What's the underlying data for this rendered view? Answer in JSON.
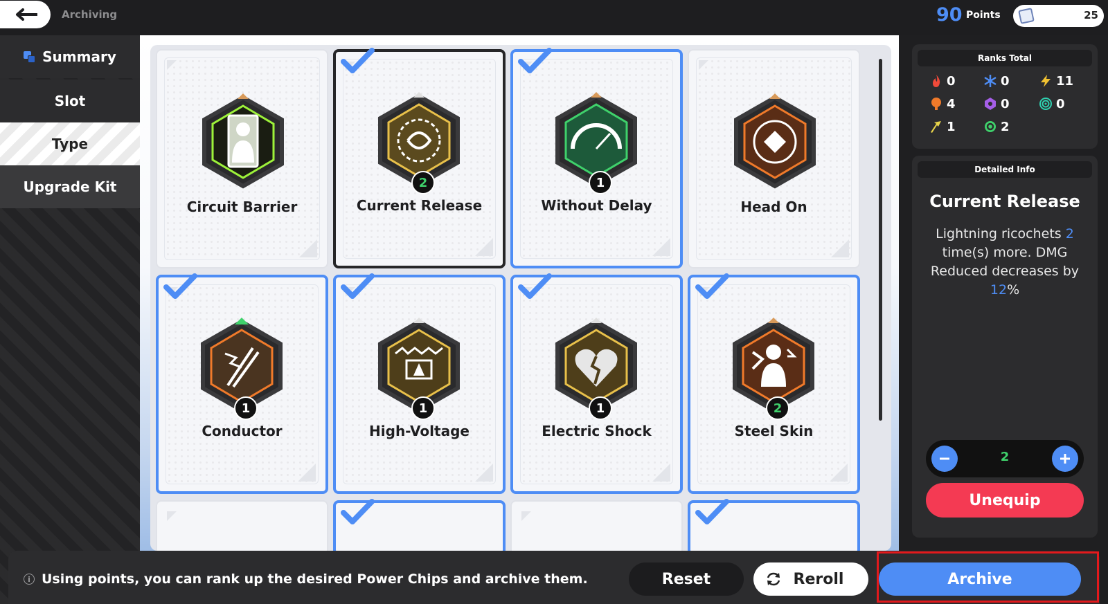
{
  "header": {
    "breadcrumb": "Archiving",
    "points_value": "90",
    "points_label": "Points",
    "upgrade_kit_count": "25"
  },
  "sidebar": {
    "items": [
      {
        "label": "Summary"
      },
      {
        "label": "Slot"
      },
      {
        "label": "Type"
      },
      {
        "label": "Upgrade Kit"
      }
    ]
  },
  "chips": [
    {
      "name": "Circuit Barrier",
      "rank": "",
      "selected": false,
      "theme": "green-neon"
    },
    {
      "name": "Current Release",
      "rank": "2",
      "selected": true,
      "theme": "gold"
    },
    {
      "name": "Without Delay",
      "rank": "1",
      "selected": true,
      "theme": "green"
    },
    {
      "name": "Head On",
      "rank": "",
      "selected": false,
      "theme": "orange"
    },
    {
      "name": "Conductor",
      "rank": "1",
      "selected": true,
      "theme": "orange"
    },
    {
      "name": "High-Voltage",
      "rank": "1",
      "selected": true,
      "theme": "gold"
    },
    {
      "name": "Electric Shock",
      "rank": "1",
      "selected": true,
      "theme": "gold"
    },
    {
      "name": "Steel Skin",
      "rank": "2",
      "selected": true,
      "theme": "orange"
    }
  ],
  "ranks_total": {
    "title": "Ranks Total",
    "items": [
      {
        "icon": "fire-icon",
        "value": "0",
        "color": "#f04a3a"
      },
      {
        "icon": "frost-icon",
        "value": "0",
        "color": "#4e8df5"
      },
      {
        "icon": "lightning-icon",
        "value": "11",
        "color": "#f1c232"
      },
      {
        "icon": "blast-icon",
        "value": "4",
        "color": "#f07a2a"
      },
      {
        "icon": "poison-icon",
        "value": "0",
        "color": "#a55ee8"
      },
      {
        "icon": "vortex-icon",
        "value": "0",
        "color": "#2fd0b0"
      },
      {
        "icon": "physical-icon",
        "value": "1",
        "color": "#e8d44a"
      },
      {
        "icon": "cycle-icon",
        "value": "2",
        "color": "#3fd16b"
      }
    ]
  },
  "detail": {
    "header": "Detailed Info",
    "title": "Current Release",
    "desc_1": "Lightning ricochets ",
    "desc_val_1": "2",
    "desc_2": " time(s) more. DMG Reduced decreases by ",
    "desc_val_2": "12",
    "desc_3": "%",
    "stepper_value": "2",
    "unequip_label": "Unequip"
  },
  "footer": {
    "tip": "Using points, you can rank up the desired Power Chips and archive them.",
    "reset_label": "Reset",
    "reroll_label": "Reroll",
    "archive_label": "Archive"
  }
}
